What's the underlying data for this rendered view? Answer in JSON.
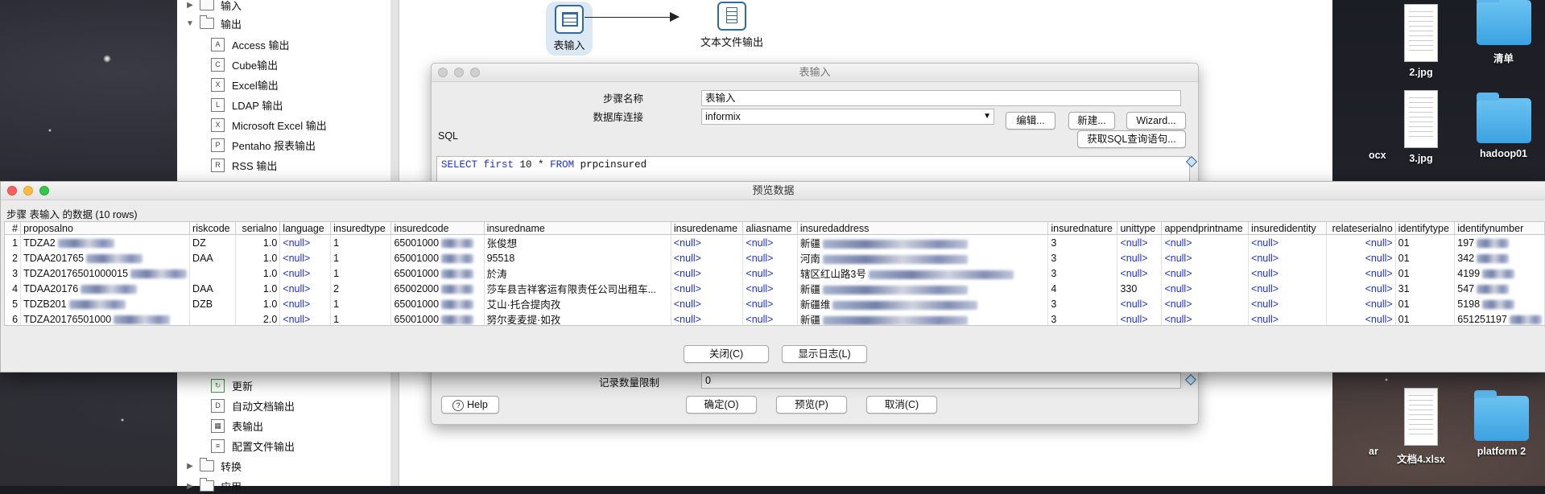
{
  "tree": {
    "items": [
      {
        "label": "输入",
        "type": "folder",
        "expanded": false
      },
      {
        "label": "输出",
        "type": "folder",
        "expanded": true
      },
      {
        "label": "Access 输出",
        "type": "step"
      },
      {
        "label": "Cube输出",
        "type": "step"
      },
      {
        "label": "Excel输出",
        "type": "step"
      },
      {
        "label": "LDAP 输出",
        "type": "step"
      },
      {
        "label": "Microsoft Excel 输出",
        "type": "step"
      },
      {
        "label": "Pentaho 报表输出",
        "type": "step"
      },
      {
        "label": "RSS 输出",
        "type": "step"
      }
    ],
    "items_bottom": [
      {
        "label": "更新",
        "type": "step"
      },
      {
        "label": "自动文档输出",
        "type": "step"
      },
      {
        "label": "表输出",
        "type": "step"
      },
      {
        "label": "配置文件输出",
        "type": "step"
      },
      {
        "label": "转换",
        "type": "folder",
        "expanded": false
      },
      {
        "label": "应用",
        "type": "folder",
        "expanded": false
      }
    ]
  },
  "canvas": {
    "steps": [
      {
        "label": "表输入",
        "icon": "table-input-icon",
        "selected": true
      },
      {
        "label": "文本文件输出",
        "icon": "text-file-output-icon",
        "selected": false
      }
    ]
  },
  "table_input_dialog": {
    "title": "表输入",
    "step_name_label": "步骤名称",
    "step_name_value": "表输入",
    "connection_label": "数据库连接",
    "connection_value": "informix",
    "edit_button": "编辑...",
    "new_button": "新建...",
    "wizard_button": "Wizard...",
    "get_sql_button": "获取SQL查询语句...",
    "sql_label": "SQL",
    "sql": {
      "select": "SELECT",
      "first": "first",
      "rest": " 10 * ",
      "from": "FROM",
      "table": " prpcinsured"
    },
    "limit_label": "记录数量限制",
    "limit_value": "0",
    "help_button": "Help",
    "ok_button": "确定(O)",
    "preview_button": "预览(P)",
    "cancel_button": "取消(C)"
  },
  "preview_window": {
    "title": "预览数据",
    "caption": "步骤 表输入 的数据  (10 rows)",
    "columns": [
      "#",
      "proposalno",
      "riskcode",
      "serialno",
      "language",
      "insuredtype",
      "insuredcode",
      "insuredname",
      "insuredename",
      "aliasname",
      "insuredaddress",
      "insurednature",
      "unittype",
      "appendprintname",
      "insuredidentity",
      "relateserialno",
      "identifytype",
      "identifynumber"
    ],
    "rows": [
      [
        "1",
        "TDZA2",
        "DZ",
        "1.0",
        "<null>",
        "1",
        "65001000",
        "张俊想",
        "<null>",
        "<null>",
        "新疆",
        "3",
        "<null>",
        "<null>",
        "<null>",
        "<null>",
        "01",
        "197"
      ],
      [
        "2",
        "TDAA201765",
        "DAA",
        "1.0",
        "<null>",
        "1",
        "65001000",
        "95518",
        "<null>",
        "<null>",
        "河南",
        "3",
        "<null>",
        "<null>",
        "<null>",
        "<null>",
        "01",
        "342"
      ],
      [
        "3",
        "TDZA20176501000015",
        "",
        "1.0",
        "<null>",
        "1",
        "65001000",
        "於涛",
        "<null>",
        "<null>",
        "辖区红山路3号",
        "3",
        "<null>",
        "<null>",
        "<null>",
        "<null>",
        "01",
        "4199"
      ],
      [
        "4",
        "TDAA20176",
        "DAA",
        "1.0",
        "<null>",
        "2",
        "65002000",
        "莎车县吉祥客运有限责任公司出租车...",
        "<null>",
        "<null>",
        "新疆",
        "4",
        "330",
        "<null>",
        "<null>",
        "<null>",
        "31",
        "547"
      ],
      [
        "5",
        "TDZB201",
        "DZB",
        "1.0",
        "<null>",
        "1",
        "65001000",
        "艾山·托合提肉孜",
        "<null>",
        "<null>",
        "新疆维",
        "3",
        "<null>",
        "<null>",
        "<null>",
        "<null>",
        "01",
        "5198"
      ],
      [
        "6",
        "TDZA20176501000",
        "",
        "2.0",
        "<null>",
        "1",
        "65001000",
        "努尔麦麦提·如孜",
        "<null>",
        "<null>",
        "新疆",
        "3",
        "<null>",
        "<null>",
        "<null>",
        "<null>",
        "01",
        "651251197"
      ]
    ],
    "close_button": "关闭(C)",
    "show_log_button": "显示日志(L)"
  },
  "desktop": {
    "files": [
      {
        "label": "2.jpg",
        "kind": "doc"
      },
      {
        "label": "清单",
        "kind": "folder"
      },
      {
        "label": "ocx",
        "kind": "partial"
      },
      {
        "label": "3.jpg",
        "kind": "doc"
      },
      {
        "label": "hadoop01",
        "kind": "folder"
      },
      {
        "label": "ar",
        "kind": "partial"
      },
      {
        "label": "文档4.xlsx",
        "kind": "xlsx"
      },
      {
        "label": "platform 2",
        "kind": "folder"
      }
    ]
  }
}
